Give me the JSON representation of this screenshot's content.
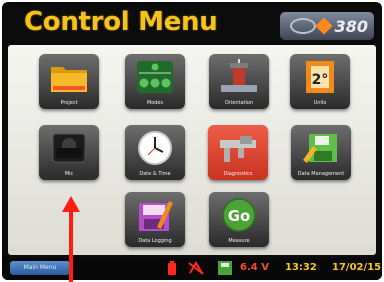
{
  "header": {
    "title": "Control Menu",
    "logo_text": "380"
  },
  "tiles": [
    {
      "label": "Project",
      "icon": "folder-icon"
    },
    {
      "label": "Modes",
      "icon": "modes-icon"
    },
    {
      "label": "Orientation",
      "icon": "orientation-icon"
    },
    {
      "label": "Units",
      "icon": "units-icon"
    },
    {
      "label": "Mic",
      "icon": "microphone-icon"
    },
    {
      "label": "Date & Time",
      "icon": "clock-icon"
    },
    {
      "label": "Diagnostics",
      "icon": "caliper-icon"
    },
    {
      "label": "Data Management",
      "icon": "floppy-disk-icon"
    },
    {
      "label": "Data Logging",
      "icon": "data-logging-icon"
    },
    {
      "label": "Measure",
      "icon": "go-icon"
    }
  ],
  "units_tile_text": "2°",
  "go_text": "Go",
  "status_bar": {
    "back_label": "Main Menu",
    "voltage": "6.4 V",
    "time": "13:32",
    "date": "17/02/15"
  },
  "colors": {
    "title": "#f4c21a",
    "active_tile": "#e0412c",
    "arrow": "#ff1d12"
  }
}
